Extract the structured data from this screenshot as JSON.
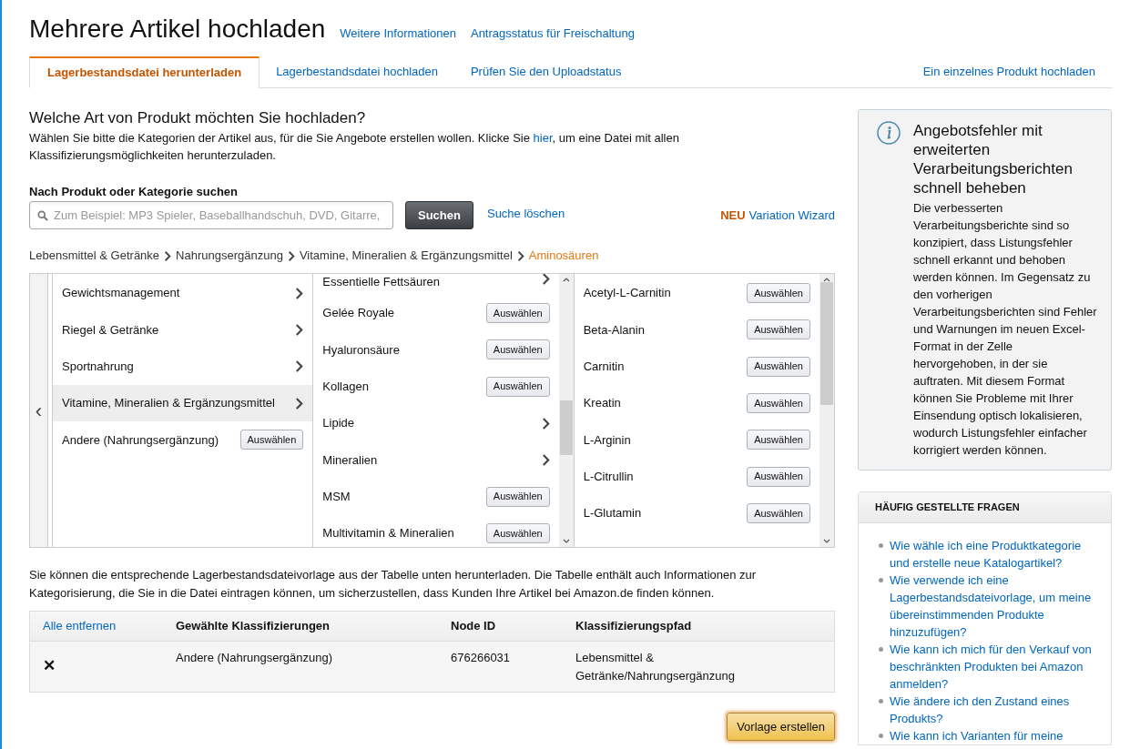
{
  "title": "Mehrere Artikel hochladen",
  "header_links": [
    "Weitere Informationen",
    "Antragsstatus für Freischaltung"
  ],
  "tabs": [
    {
      "label": "Lagerbestandsdatei herunterladen",
      "selected": true
    },
    {
      "label": "Lagerbestandsdatei hochladen",
      "selected": false
    },
    {
      "label": "Prüfen Sie den Uploadstatus",
      "selected": false
    }
  ],
  "single_product_link": "Ein einzelnes Produkt hochladen",
  "question": "Welche Art von Produkt möchten Sie hochladen?",
  "intro": {
    "before": "Wählen Sie bitte die Kategorien der Artikel aus, für die Sie Angebote erstellen wollen. Klicke Sie ",
    "link": "hier",
    "after": ", um eine Datei mit allen Klassifizierungsmöglichkeiten herunterzuladen."
  },
  "search": {
    "label": "Nach Produkt oder Kategorie suchen",
    "placeholder": "Zum Beispiel: MP3 Spieler, Baseballhandschuh, DVD, Gitarre,",
    "button": "Suchen",
    "clear": "Suche löschen"
  },
  "wizard": {
    "badge": "NEU",
    "label": "Variation Wizard"
  },
  "breadcrumb": [
    {
      "label": "Lebensmittel & Getränke",
      "selected": false
    },
    {
      "label": "Nahrungsergänzung",
      "selected": false
    },
    {
      "label": "Vitamine, Mineralien & Ergänzungsmittel",
      "selected": false
    },
    {
      "label": "Aminosäuren",
      "selected": true
    }
  ],
  "browser": {
    "back": "‹",
    "columns": [
      {
        "items": [
          {
            "label": "Gewichtsmanagement",
            "kind": "branch",
            "selected": false
          },
          {
            "label": "Riegel & Getränke",
            "kind": "branch",
            "selected": false
          },
          {
            "label": "Sportnahrung",
            "kind": "branch",
            "selected": false
          },
          {
            "label": "Vitamine, Mineralien & Ergänzungsmittel",
            "kind": "branch",
            "selected": true
          },
          {
            "label": "Andere (Nahrungsergänzung)",
            "kind": "leaf",
            "button": "Auswählen",
            "selected": false
          }
        ]
      },
      {
        "scrollbar": true,
        "items": [
          {
            "label": "Essentielle Fettsäuren",
            "kind": "branch",
            "selected": false
          },
          {
            "label": "Gelée Royale",
            "kind": "leaf",
            "button": "Auswählen",
            "selected": false
          },
          {
            "label": "Hyaluronsäure",
            "kind": "leaf",
            "button": "Auswählen",
            "selected": false
          },
          {
            "label": "Kollagen",
            "kind": "leaf",
            "button": "Auswählen",
            "selected": false
          },
          {
            "label": "Lipide",
            "kind": "branch",
            "selected": false
          },
          {
            "label": "Mineralien",
            "kind": "branch",
            "selected": false
          },
          {
            "label": "MSM",
            "kind": "leaf",
            "button": "Auswählen",
            "selected": false
          },
          {
            "label": "Multivitamin & Mineralien",
            "kind": "leaf",
            "button": "Auswählen",
            "selected": false
          }
        ]
      },
      {
        "scrollbar": true,
        "items": [
          {
            "label": "Acetyl-L-Carnitin",
            "kind": "leaf",
            "button": "Auswählen",
            "selected": false
          },
          {
            "label": "Beta-Alanin",
            "kind": "leaf",
            "button": "Auswählen",
            "selected": false
          },
          {
            "label": "Carnitin",
            "kind": "leaf",
            "button": "Auswählen",
            "selected": false
          },
          {
            "label": "Kreatin",
            "kind": "leaf",
            "button": "Auswählen",
            "selected": false
          },
          {
            "label": "L-Arginin",
            "kind": "leaf",
            "button": "Auswählen",
            "selected": false
          },
          {
            "label": "L-Citrullin",
            "kind": "leaf",
            "button": "Auswählen",
            "selected": false
          },
          {
            "label": "L-Glutamin",
            "kind": "leaf",
            "button": "Auswählen",
            "selected": false
          }
        ]
      }
    ]
  },
  "table_note": "Sie können die entsprechende Lagerbestandsdateivorlage aus der Tabelle unten herunterladen. Die Tabelle enthält auch Informationen zur Kategorisierung, die Sie in die Datei eintragen können, um sicherzustellen, dass Kunden Ihre Artikel bei Amazon.de finden können.",
  "table": {
    "remove_all": "Alle entfernen",
    "columns": [
      "Gewählte Klassifizierungen",
      "Node ID",
      "Klassifizierungspfad"
    ],
    "rows": [
      {
        "remove": "✕",
        "cells": [
          "Andere (Nahrungsergänzung)",
          "676266031",
          "Lebensmittel & Getränke/Nahrungsergänzung"
        ]
      }
    ]
  },
  "create_button": "Vorlage erstellen",
  "info": {
    "title": "Angebotsfehler mit erweiterten Verarbeitungsberichten schnell beheben",
    "body": "Die verbesserten Verarbeitungsberichte sind so konzipiert, dass Listungsfehler schnell erkannt und behoben werden können. Im Gegensatz zu den vorherigen Verarbeitungsberichten sind Fehler und Warnungen im neuen Excel-Format in der Zelle hervorgehoben, in der sie auftraten. Mit diesem Format können Sie Probleme mit Ihrer Einsendung optisch lokalisieren, wodurch Listungsfehler einfacher korrigiert werden können."
  },
  "faq": {
    "title": "HÄUFIG GESTELLTE FRAGEN",
    "items": [
      "Wie wähle ich eine Produktkategorie und erstelle neue Katalogartikel?",
      "Wie verwende ich eine Lagerbestandsdateivorlage, um meine übereinstimmenden Produkte hinzuzufügen?",
      "Wie kann ich mich für den Verkauf von beschränkten Produkten bei Amazon anmelden?",
      "Wie ändere ich den Zustand eines Produkts?",
      "Wie kann ich Varianten für meine"
    ]
  }
}
